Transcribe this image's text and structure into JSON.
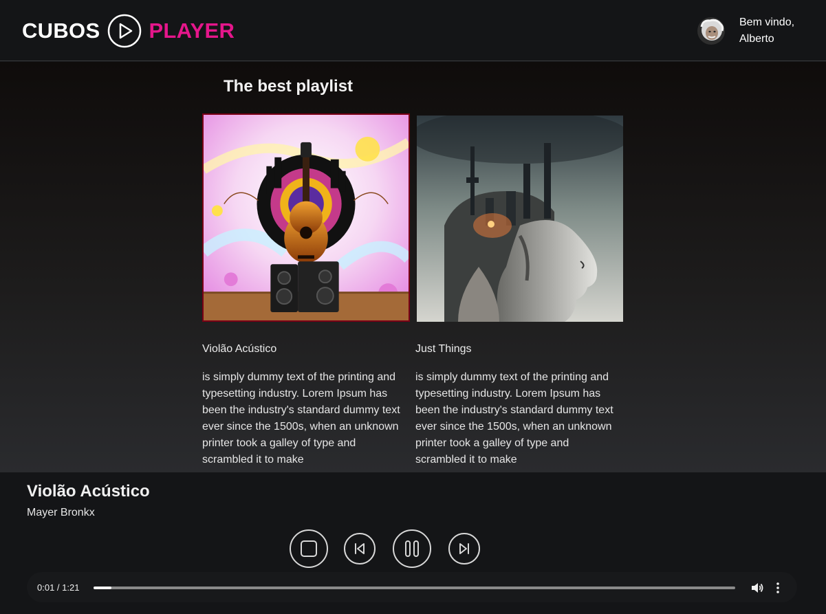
{
  "header": {
    "logo_left": "CUBOS",
    "logo_right": "PLAYER",
    "greeting": "Bem vindo,",
    "user_name": "Alberto"
  },
  "main": {
    "section_title": "The best playlist",
    "cards": [
      {
        "title": "Violão Acústico",
        "description": "is simply dummy text of the printing and typesetting industry. Lorem Ipsum has been the industry's standard dummy text ever since the 1500s, when an unknown printer took a galley of type and scrambled it to make"
      },
      {
        "title": "Just Things",
        "description": "is simply dummy text of the printing and typesetting industry. Lorem Ipsum has been the industry's standard dummy text ever since the 1500s, when an unknown printer took a galley of type and scrambled it to make"
      }
    ]
  },
  "player": {
    "track_title": "Violão Acústico",
    "artist": "Mayer Bronkx",
    "time_display": "0:01 / 1:21",
    "progress": 0.028
  },
  "colors": {
    "accent": "#e5168b",
    "background": "#141517",
    "selected_border": "#7a0015"
  },
  "icons": {
    "logo": "play-circle-icon",
    "stop": "stop-icon",
    "previous": "skip-previous-icon",
    "pause": "pause-icon",
    "next": "skip-next-icon",
    "volume": "volume-icon",
    "more": "more-vertical-icon"
  }
}
